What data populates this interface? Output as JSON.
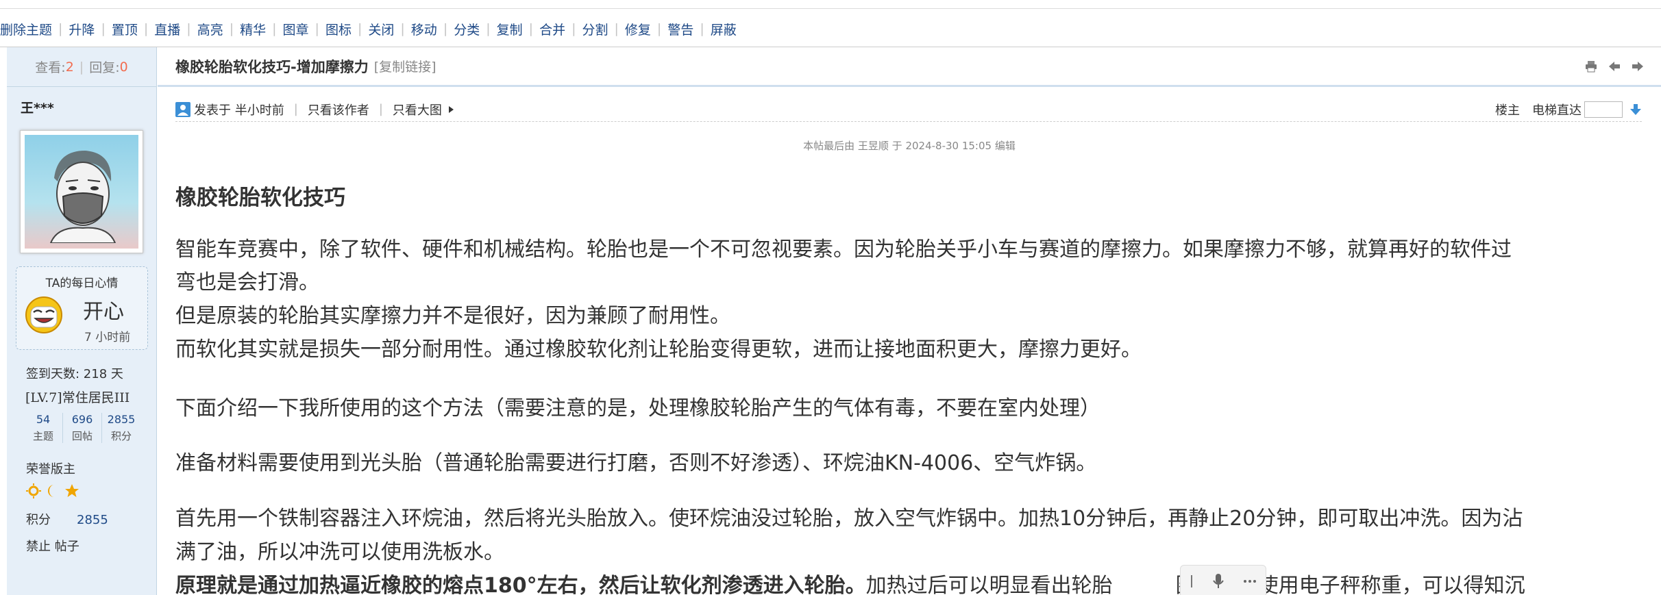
{
  "mod_actions": [
    "删除主题",
    "升降",
    "置顶",
    "直播",
    "高亮",
    "精华",
    "图章",
    "图标",
    "关闭",
    "移动",
    "分类",
    "复制",
    "合并",
    "分割",
    "修复",
    "警告",
    "屏蔽"
  ],
  "stats": {
    "views_label": "查看:",
    "views": "2",
    "replies_label": "回复:",
    "replies": "0"
  },
  "author": {
    "name": "王***",
    "mood_title": "TA的每日心情",
    "mood": "开心",
    "mood_time": "7 小时前",
    "sign_days": "签到天数: 218 天",
    "level": "[LV.7]常住居民III",
    "counts": [
      {
        "num": "54",
        "label": "主题"
      },
      {
        "num": "696",
        "label": "回帖"
      },
      {
        "num": "2855",
        "label": "积分"
      }
    ],
    "honor": "荣誉版主",
    "points_label": "积分",
    "points": "2855",
    "ban": "禁止 帖子"
  },
  "post": {
    "title": "橡胶轮胎软化技巧-增加摩擦力",
    "copy_link": "[复制链接]",
    "posted": "发表于 半小时前",
    "only_author": "只看该作者",
    "big_image": "只看大图",
    "floor": "楼主",
    "elevator": "电梯直达",
    "edit_note": "本帖最后由 王昱顺 于 2024-8-30 15:05 编辑",
    "heading": "橡胶轮胎软化技巧",
    "p1_line1": "智能车竞赛中，除了软件、硬件和机械结构。轮胎也是一个不可忽视要素。因为轮胎关乎小车与赛道的摩擦力。如果摩擦力不够，就算再好的软件过",
    "p1_line2": "弯也是会打滑。",
    "p1_line3": "但是原装的轮胎其实摩擦力并不是很好，因为兼顾了耐用性。",
    "p1_line4": "而软化其实就是损失一部分耐用性。通过橡胶软化剂让轮胎变得更软，进而让接地面积更大，摩擦力更好。",
    "p2": "下面介绍一下我所使用的这个方法（需要注意的是，处理橡胶轮胎产生的气体有毒，不要在室内处理）",
    "p3": "准备材料需要使用到光头胎（普通轮胎需要进行打磨，否则不好渗透）、环烷油KN-4006、空气炸锅。",
    "p4_line1": "首先用一个铁制容器注入环烷油，然后将光头胎放入。使环烷油没过轮胎，放入空气炸锅中。加热10分钟后，再静止20分钟，即可取出冲洗。因为沾",
    "p4_line2": "满了油，所以冲洗可以使用洗板水。",
    "p5_bold": "原理就是通过加热逼近橡胶的熔点180°左右，然后让软化剂渗透进入轮胎。",
    "p5_rest_a": "加热过后可以明显看出轮胎",
    "p5_rest_b": "圈。并且使用电子秤称重，可以得知沉"
  },
  "icons": [
    "print-icon",
    "prev-thread-icon",
    "next-thread-icon",
    "author-icon",
    "arrow-right-icon",
    "go-down-icon",
    "mood-happy-icon",
    "sun-medal-icon",
    "moon-medal-icon",
    "star-medal-icon",
    "mic-icon",
    "more-icon"
  ]
}
